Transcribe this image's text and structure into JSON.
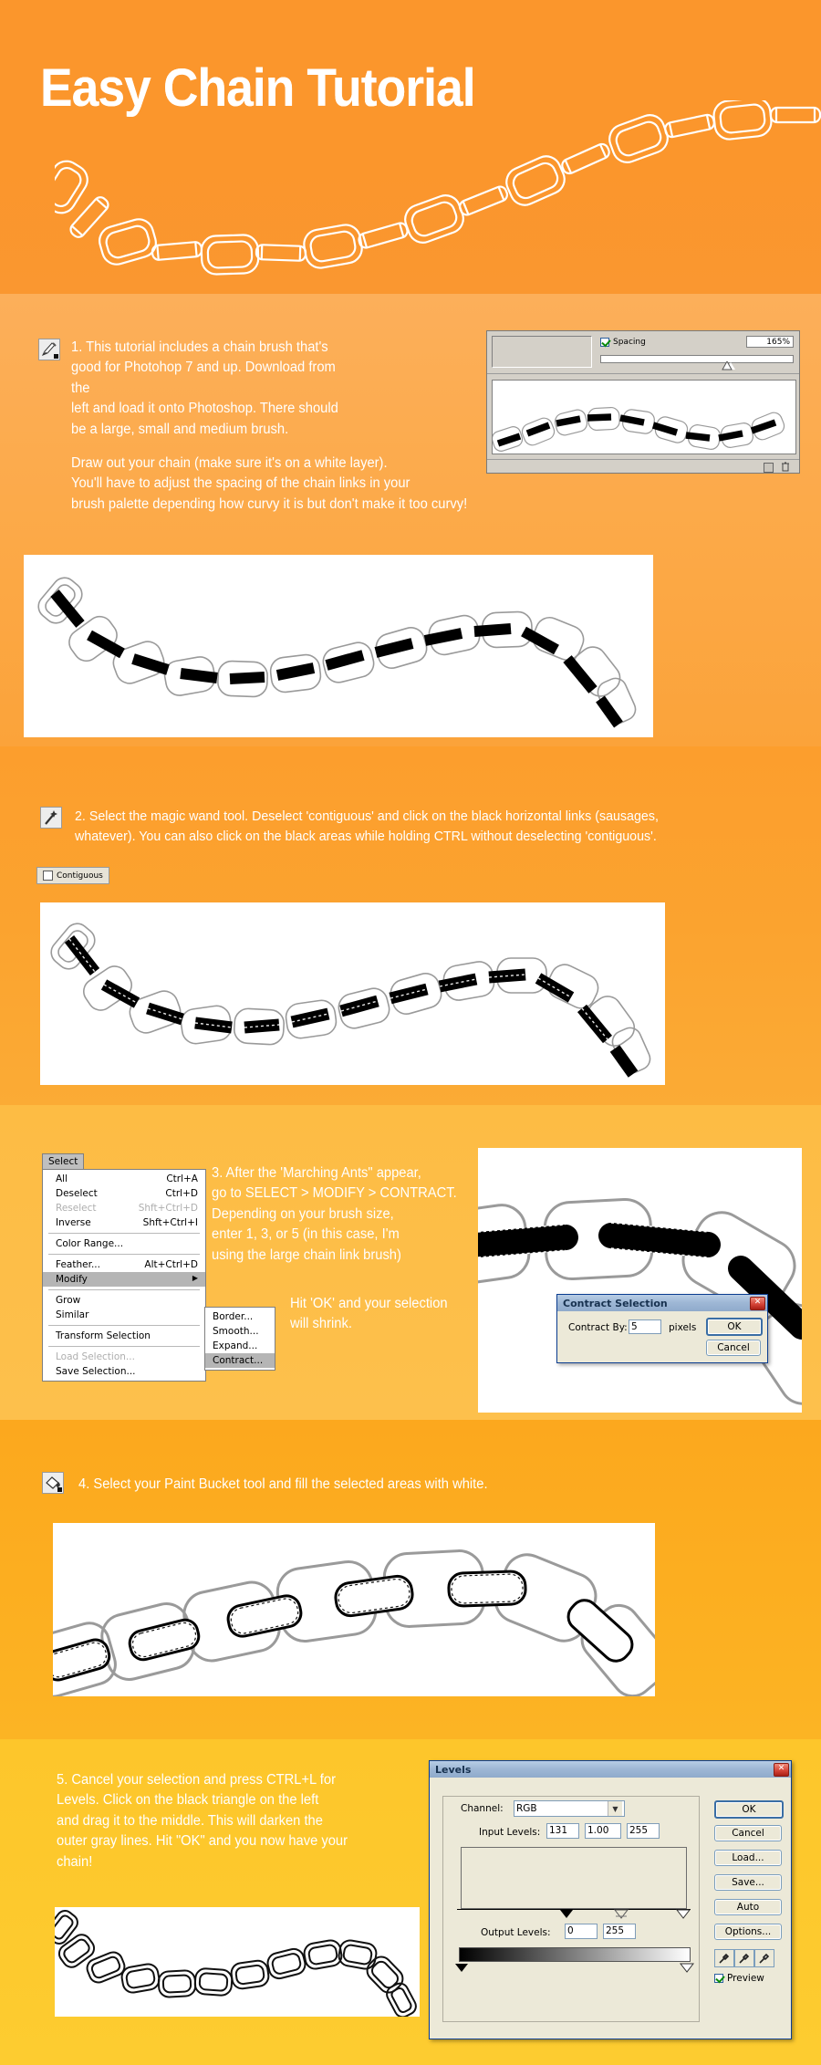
{
  "hero": {
    "title": "Easy Chain Tutorial",
    "background_color": "#FB962C",
    "chain_color": "#FFFFFF"
  },
  "steps": [
    {
      "number": "1",
      "icon": "paintbrush-tool-icon",
      "paragraph_1": "1. This tutorial includes a chain brush that's\ngood for Photohop 7 and up. Download from the\nleft and load it onto Photoshop. There should\nbe a large, small and medium brush.",
      "paragraph_2": "Draw out your chain (make sure it's on a white layer).\nYou'll have to adjust the spacing of the chain links in your\nbrush palette depending how curvy it is but don't make it too curvy!"
    },
    {
      "number": "2",
      "icon": "magic-wand-tool-icon",
      "paragraph_1": "2. Select the magic wand tool. Deselect 'contiguous' and click on the black horizontal links (sausages,\nwhatever). You can also click on the black areas while holding CTRL without deselecting 'contiguous'."
    },
    {
      "number": "3",
      "paragraph_1": "3. After the 'Marching Ants\" appear,\ngo to SELECT > MODIFY > CONTRACT.\nDepending on your brush size,\nenter 1, 3, or 5 (in this case, I'm\nusing the large chain link brush)",
      "paragraph_2": "Hit 'OK' and your selection\nwill shrink."
    },
    {
      "number": "4",
      "icon": "paint-bucket-tool-icon",
      "paragraph_1": "4. Select your Paint Bucket tool and fill the selected areas with white."
    },
    {
      "number": "5",
      "paragraph_1": "5. Cancel your selection and press CTRL+L for\nLevels. Click on the black triangle on the left\nand drag it to the middle. This will darken the\nouter gray lines. Hit \"OK\" and you now have your\nchain!"
    }
  ],
  "brush_panel": {
    "spacing_label": "Spacing",
    "spacing_value": "165%",
    "spacing_checked": true
  },
  "contiguous_option": {
    "label": "Contiguous",
    "checked": false
  },
  "select_menu": {
    "menu_title": "Select",
    "items": [
      {
        "label": "All",
        "shortcut": "Ctrl+A",
        "enabled": true
      },
      {
        "label": "Deselect",
        "shortcut": "Ctrl+D",
        "enabled": true
      },
      {
        "label": "Reselect",
        "shortcut": "Shft+Ctrl+D",
        "enabled": false
      },
      {
        "label": "Inverse",
        "shortcut": "Shft+Ctrl+I",
        "enabled": true
      },
      {
        "label": "Color Range...",
        "shortcut": "",
        "enabled": true
      },
      {
        "label": "Feather...",
        "shortcut": "Alt+Ctrl+D",
        "enabled": true
      },
      {
        "label": "Modify",
        "shortcut": "",
        "enabled": true,
        "submenu": true,
        "highlighted": true
      },
      {
        "label": "Grow",
        "shortcut": "",
        "enabled": true
      },
      {
        "label": "Similar",
        "shortcut": "",
        "enabled": true
      },
      {
        "label": "Transform Selection",
        "shortcut": "",
        "enabled": true
      },
      {
        "label": "Load Selection...",
        "shortcut": "",
        "enabled": false
      },
      {
        "label": "Save Selection...",
        "shortcut": "",
        "enabled": true
      }
    ],
    "submenu_items": [
      {
        "label": "Border...",
        "highlighted": false
      },
      {
        "label": "Smooth...",
        "highlighted": false
      },
      {
        "label": "Expand...",
        "highlighted": false
      },
      {
        "label": "Contract...",
        "highlighted": true
      }
    ]
  },
  "contract_dialog": {
    "title": "Contract Selection",
    "field_label": "Contract By:",
    "value": "5",
    "units": "pixels",
    "ok": "OK",
    "cancel": "Cancel",
    "close": "✕"
  },
  "levels_dialog": {
    "title": "Levels",
    "channel_label": "Channel:",
    "channel_value": "RGB",
    "input_label": "Input Levels:",
    "input_black": "131",
    "input_gamma": "1.00",
    "input_white": "255",
    "output_label": "Output Levels:",
    "output_black": "0",
    "output_white": "255",
    "buttons": [
      "OK",
      "Cancel",
      "Load...",
      "Save...",
      "Auto",
      "Options..."
    ],
    "preview_label": "Preview",
    "preview_checked": true,
    "close": "✕"
  }
}
